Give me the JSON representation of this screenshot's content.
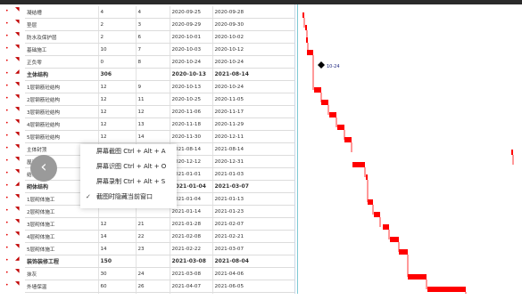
{
  "rows": [
    {
      "name": "凝结槽",
      "a": "4",
      "b": "4",
      "start": "2020-09-25",
      "end": "2020-09-28",
      "bold": false
    },
    {
      "name": "垫层",
      "a": "2",
      "b": "3",
      "start": "2020-09-29",
      "end": "2020-09-30",
      "bold": false
    },
    {
      "name": "防水及保护层",
      "a": "2",
      "b": "6",
      "start": "2020-10-01",
      "end": "2020-10-02",
      "bold": false
    },
    {
      "name": "基础施工",
      "a": "10",
      "b": "7",
      "start": "2020-10-03",
      "end": "2020-10-12",
      "bold": false
    },
    {
      "name": "正负零",
      "a": "0",
      "b": "8",
      "start": "2020-10-24",
      "end": "2020-10-24",
      "bold": false
    },
    {
      "name": "主体结构",
      "a": "306",
      "b": "",
      "start": "2020-10-13",
      "end": "2021-08-14",
      "bold": true
    },
    {
      "name": "1层钢筋砼结构",
      "a": "12",
      "b": "9",
      "start": "2020-10-13",
      "end": "2020-10-24",
      "bold": false
    },
    {
      "name": "2层钢筋砼结构",
      "a": "12",
      "b": "11",
      "start": "2020-10-25",
      "end": "2020-11-05",
      "bold": false
    },
    {
      "name": "3层钢筋砼结构",
      "a": "12",
      "b": "12",
      "start": "2020-11-06",
      "end": "2020-11-17",
      "bold": false
    },
    {
      "name": "4层钢筋砼结构",
      "a": "12",
      "b": "13",
      "start": "2020-11-18",
      "end": "2020-11-29",
      "bold": false
    },
    {
      "name": "5层钢筋砼结构",
      "a": "12",
      "b": "14",
      "start": "2020-11-30",
      "end": "2020-12-11",
      "bold": false
    },
    {
      "name": "主体封顶",
      "a": "",
      "b": "",
      "start": "2021-08-14",
      "end": "2021-08-14",
      "bold": false
    },
    {
      "name": "屋面工程",
      "a": "",
      "b": "",
      "start": "2020-12-12",
      "end": "2020-12-31",
      "bold": false
    },
    {
      "name": "结构验收",
      "a": "",
      "b": "",
      "start": "2021-01-01",
      "end": "2021-01-03",
      "bold": false
    },
    {
      "name": "砌体结构",
      "a": "",
      "b": "",
      "start": "2021-01-04",
      "end": "2021-03-07",
      "bold": true
    },
    {
      "name": "1层砌体施工",
      "a": "",
      "b": "",
      "start": "2021-01-04",
      "end": "2021-01-13",
      "bold": false
    },
    {
      "name": "2层砌体施工",
      "a": "",
      "b": "",
      "start": "2021-01-14",
      "end": "2021-01-23",
      "bold": false
    },
    {
      "name": "3层砌体施工",
      "a": "12",
      "b": "21",
      "start": "2021-01-28",
      "end": "2021-02-07",
      "bold": false
    },
    {
      "name": "4层砌体施工",
      "a": "14",
      "b": "22",
      "start": "2021-02-08",
      "end": "2021-02-21",
      "bold": false
    },
    {
      "name": "5层砌体施工",
      "a": "14",
      "b": "23",
      "start": "2021-02-22",
      "end": "2021-03-07",
      "bold": false
    },
    {
      "name": "装饰装修工程",
      "a": "150",
      "b": "",
      "start": "2021-03-08",
      "end": "2021-08-04",
      "bold": true
    },
    {
      "name": "抹灰",
      "a": "30",
      "b": "24",
      "start": "2021-03-08",
      "end": "2021-04-06",
      "bold": false
    },
    {
      "name": "外墙保温",
      "a": "60",
      "b": "26",
      "start": "2021-04-07",
      "end": "2021-06-05",
      "bold": false
    },
    {
      "name": "精装",
      "a": "60",
      "b": "27",
      "start": "2021-06-06",
      "end": "2021-08-04",
      "bold": false
    }
  ],
  "milestone_label": "10-24",
  "context_menu": {
    "items": [
      {
        "label": "屏幕截图 Ctrl + Alt + A",
        "checked": false
      },
      {
        "label": "屏幕识图 Ctrl + Alt + O",
        "checked": false
      },
      {
        "label": "屏幕录制 Ctrl + Alt + S",
        "checked": false
      },
      {
        "label": "截图时隐藏当前窗口",
        "checked": true
      }
    ]
  },
  "back_button": {
    "icon": "chevron-left-icon",
    "glyph": "‹"
  },
  "colors": {
    "bar": "#ff0000",
    "grid": "#dcdcdc",
    "divider": "#7ec9d4"
  }
}
